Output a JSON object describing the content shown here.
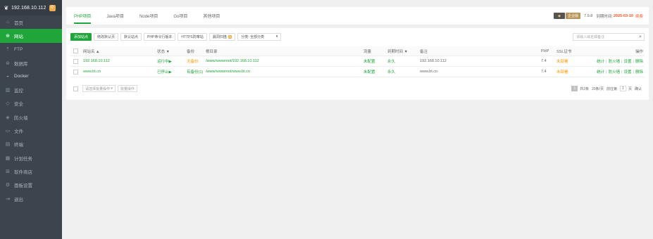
{
  "sidebar": {
    "ip": "192.168.10.112",
    "badge": "0",
    "items": [
      {
        "label": "首页",
        "icon": "home-icon"
      },
      {
        "label": "网站",
        "icon": "globe-icon"
      },
      {
        "label": "FTP",
        "icon": "ftp-icon"
      },
      {
        "label": "数据库",
        "icon": "database-icon"
      },
      {
        "label": "Docker",
        "icon": "docker-icon"
      },
      {
        "label": "监控",
        "icon": "monitor-icon"
      },
      {
        "label": "安全",
        "icon": "shield-icon"
      },
      {
        "label": "防火墙",
        "icon": "firewall-icon"
      },
      {
        "label": "文件",
        "icon": "folder-icon"
      },
      {
        "label": "终端",
        "icon": "terminal-icon"
      },
      {
        "label": "计划任务",
        "icon": "calendar-icon"
      },
      {
        "label": "软件商店",
        "icon": "grid-icon"
      },
      {
        "label": "面板设置",
        "icon": "gear-icon"
      },
      {
        "label": "退出",
        "icon": "logout-icon"
      }
    ]
  },
  "tabs": [
    "PHP项目",
    "Java项目",
    "Node项目",
    "Go项目",
    "其他项目"
  ],
  "topright": {
    "badge": "企业版",
    "version": "7.9.8",
    "expire_label": "到期时间:",
    "expire_date": "2025-03-10",
    "renew": "续费"
  },
  "toolbar": {
    "add_site": "添加站点",
    "modify_default_page": "修改默认页",
    "default_site": "默认站点",
    "php_cli": "PHP命令行版本",
    "https_proxy": "HTTPS防窜站",
    "vuln_scan": "漏洞扫描",
    "vuln_count": "0",
    "category": "分类: 全部分类",
    "search_placeholder": "请输入域名或备注"
  },
  "table": {
    "headers": {
      "name": "网站名 ▲",
      "status": "状态 ▼",
      "backup": "备份",
      "root": "根目录",
      "traffic": "流量",
      "expire": "到期时间 ▼",
      "remark": "备注",
      "php": "PHP",
      "ssl": "SSL证书",
      "ops": "操作"
    },
    "rows": [
      {
        "name": "192.168.10.112",
        "status": "运行中▶",
        "backup": "无备份",
        "root": "/www/wwwroot/192.168.10.112",
        "traffic": "未配置",
        "expire": "永久",
        "remark": "192.168.10.112",
        "php": "7.4",
        "ssl": "未部署",
        "ops": [
          "统计",
          "防火墙",
          "设置",
          "删除"
        ]
      },
      {
        "name": "www.bt.cn",
        "status": "已停止▶",
        "backup": "有备份(1)",
        "root": "/www/wwwroot/www.bt.cn",
        "traffic": "未配置",
        "expire": "永久",
        "remark": "www.bt.cn",
        "php": "7.4",
        "ssl": "未部署",
        "ops": [
          "统计",
          "防火墙",
          "设置",
          "删除"
        ]
      }
    ]
  },
  "footer": {
    "batch_select": "请选择批量操作",
    "batch_btn": "批量操作",
    "current_page": "1",
    "total": "共2条",
    "per_page": "20条/页",
    "goto": "前往第",
    "page_input": "1",
    "page_unit": "页",
    "confirm": "确认"
  }
}
